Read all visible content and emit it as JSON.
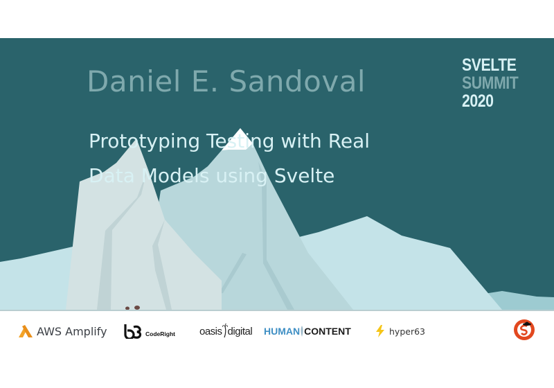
{
  "slide": {
    "speaker": "Daniel E. Sandoval",
    "title_lines": [
      "Prototyping Testing with Real",
      "Data Models using Svelte"
    ],
    "event_logo": {
      "line1": "SVELTE",
      "line2": "SUMMIT",
      "line3": "2020"
    },
    "colors": {
      "background": "#2a636b",
      "speaker": "#7fa9ad",
      "title": "#d8f1f4"
    }
  },
  "sponsors": [
    {
      "name": "AWS Amplify",
      "icon": "aws-amplify-logo-icon"
    },
    {
      "name": "CodeRight",
      "icon": "b3-logo-icon"
    },
    {
      "name_a": "oasis",
      "name_b": "digital",
      "icon": "palm-tree-icon"
    },
    {
      "name_a": "HUMAN",
      "name_b": "CONTENT",
      "icon": "feather-icon"
    },
    {
      "name": "hyper63",
      "icon": "lightning-bolt-icon"
    },
    {
      "name": "Svelte Society",
      "icon": "svelte-society-logo-icon"
    }
  ]
}
